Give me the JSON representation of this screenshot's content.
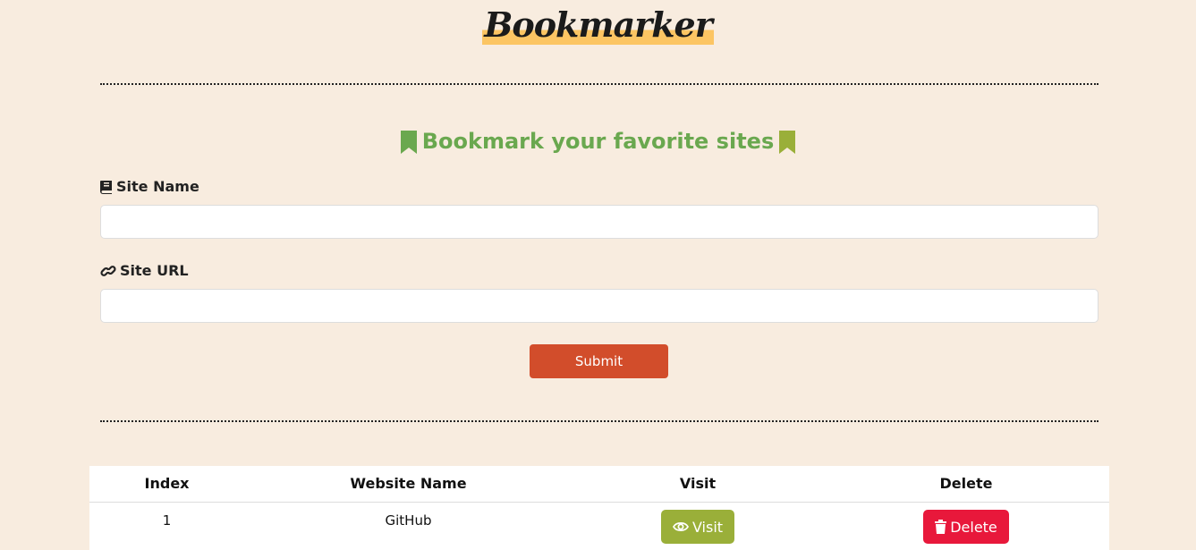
{
  "app": {
    "title": "Bookmarker"
  },
  "form": {
    "heading": "Bookmark your favorite sites",
    "site_name_label": "Site Name",
    "site_name_value": "",
    "site_url_label": "Site URL",
    "site_url_value": "",
    "submit_label": "Submit"
  },
  "table": {
    "headers": [
      "Index",
      "Website Name",
      "Visit",
      "Delete"
    ],
    "rows": [
      {
        "index": "1",
        "name": "GitHub",
        "visit_label": "Visit",
        "delete_label": "Delete"
      }
    ]
  },
  "icons": {
    "heading_left": "bookmark-icon",
    "heading_right": "bookmark-icon",
    "site_name": "book-icon",
    "site_url": "link-icon",
    "visit": "eye-icon",
    "delete": "trash-icon"
  },
  "colors": {
    "background": "#f8ecdf",
    "accent_green": "#6aa84f",
    "logo_highlight": "#fcc563",
    "submit": "#d24d2b",
    "visit": "#9aaf39",
    "delete": "#e8183b"
  }
}
